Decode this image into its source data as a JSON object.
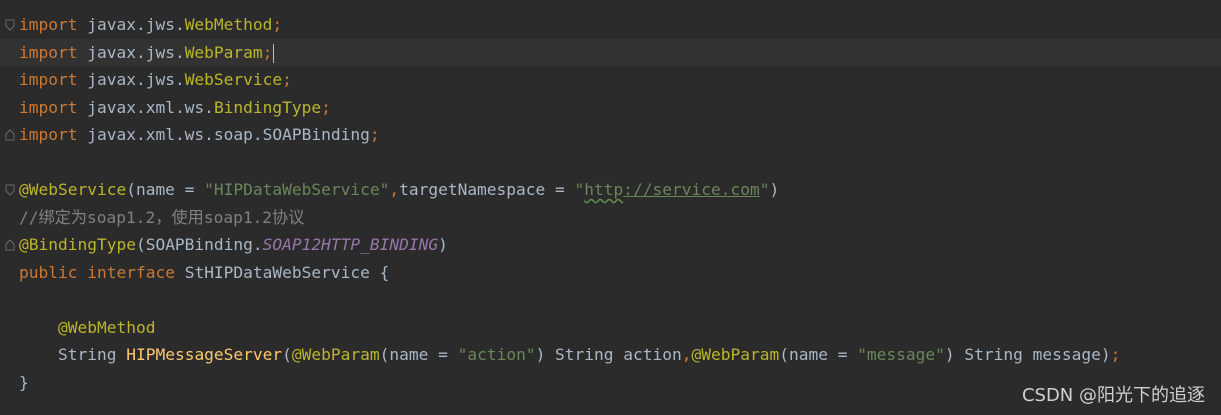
{
  "editor": {
    "lines": {
      "l1": {
        "kw": "import",
        "pkg": " javax.jws.",
        "cls": "WebMethod",
        "end": ";"
      },
      "l2": {
        "kw": "import",
        "pkg": " javax.jws.",
        "cls": "WebParam",
        "end": ";"
      },
      "l3": {
        "kw": "import",
        "pkg": " javax.jws.",
        "cls": "WebService",
        "end": ";"
      },
      "l4": {
        "kw": "import",
        "pkg": " javax.xml.ws.",
        "cls": "BindingType",
        "end": ";"
      },
      "l5": {
        "kw": "import",
        "pkg": " javax.xml.ws.soap.SOAPBinding",
        "end": ";"
      },
      "l7": {
        "ann": "@WebService",
        "p1": "(name = ",
        "s1": "\"HIPDataWebService\"",
        "comma": ",",
        "p2": "targetNamespace = ",
        "q1": "\"",
        "url_http": "http",
        "url_rest": "://service.com",
        "q2": "\"",
        "p3": ")"
      },
      "l8": {
        "comment": "//绑定为soap1.2，使用soap1.2协议"
      },
      "l9": {
        "ann": "@BindingType",
        "p1": "(SOAPBinding.",
        "const": "SOAP12HTTP_BINDING",
        "p2": ")"
      },
      "l10": {
        "kw1": "public",
        "sp": " ",
        "kw2": "interface",
        "rest": " StHIPDataWebService {"
      },
      "l12": {
        "ann": "@WebMethod"
      },
      "l13": {
        "t1": "String ",
        "fn": "HIPMessageServer",
        "p1": "(",
        "a1": "@WebParam",
        "p2": "(name = ",
        "s1": "\"action\"",
        "p3": ") String action",
        "comma": ",",
        "a2": "@WebParam",
        "p4": "(name = ",
        "s2": "\"message\"",
        "p5": ") String message)",
        "end": ";"
      },
      "l14": {
        "text": "}"
      }
    }
  },
  "watermark": "CSDN @阳光下的追逐",
  "colors": {
    "background": "#2b2b2b",
    "keyword": "#cc7832",
    "annotation": "#bbb529",
    "string": "#6a8759",
    "comment": "#808080",
    "method": "#ffc66d",
    "constant": "#9876aa",
    "text": "#a9b7c6"
  }
}
